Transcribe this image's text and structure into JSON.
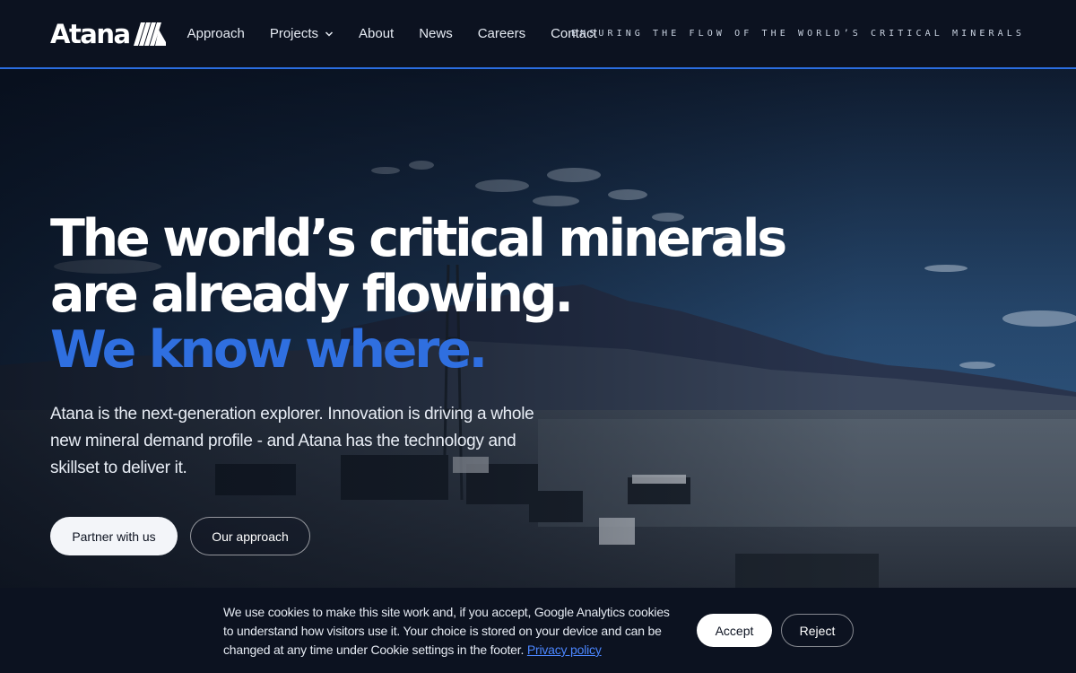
{
  "nav": {
    "logo_text": "Atana",
    "links": [
      {
        "label": "Approach"
      },
      {
        "label": "Projects",
        "icon": "chevron-down-icon"
      },
      {
        "label": "About"
      },
      {
        "label": "News"
      },
      {
        "label": "Careers"
      },
      {
        "label": "Contact"
      }
    ],
    "tagline": "ENSURING THE FLOW OF THE WORLD’S CRITICAL MINERALS"
  },
  "hero": {
    "headline_line1": "The world’s critical minerals",
    "headline_line2": "are already flowing.",
    "headline_line3": "We know where.",
    "subcopy": "Atana is the next-generation explorer. Innovation is driving a whole new mineral demand profile - and Atana has the technology and skillset to deliver it.",
    "primary_button": "Partner with us",
    "secondary_button": "Our approach"
  },
  "cookie": {
    "text": "We use cookies to make this site work and, if you accept, Google Analytics cookies to understand how visitors use it. Your choice is stored on your device and can be changed at any time under Cookie settings in the footer.",
    "link": "Privacy policy",
    "accept": "Accept",
    "reject": "Reject"
  },
  "colors": {
    "accent": "#2f6fe0",
    "nav_bg": "#0c1220",
    "link": "#4b86ff"
  }
}
